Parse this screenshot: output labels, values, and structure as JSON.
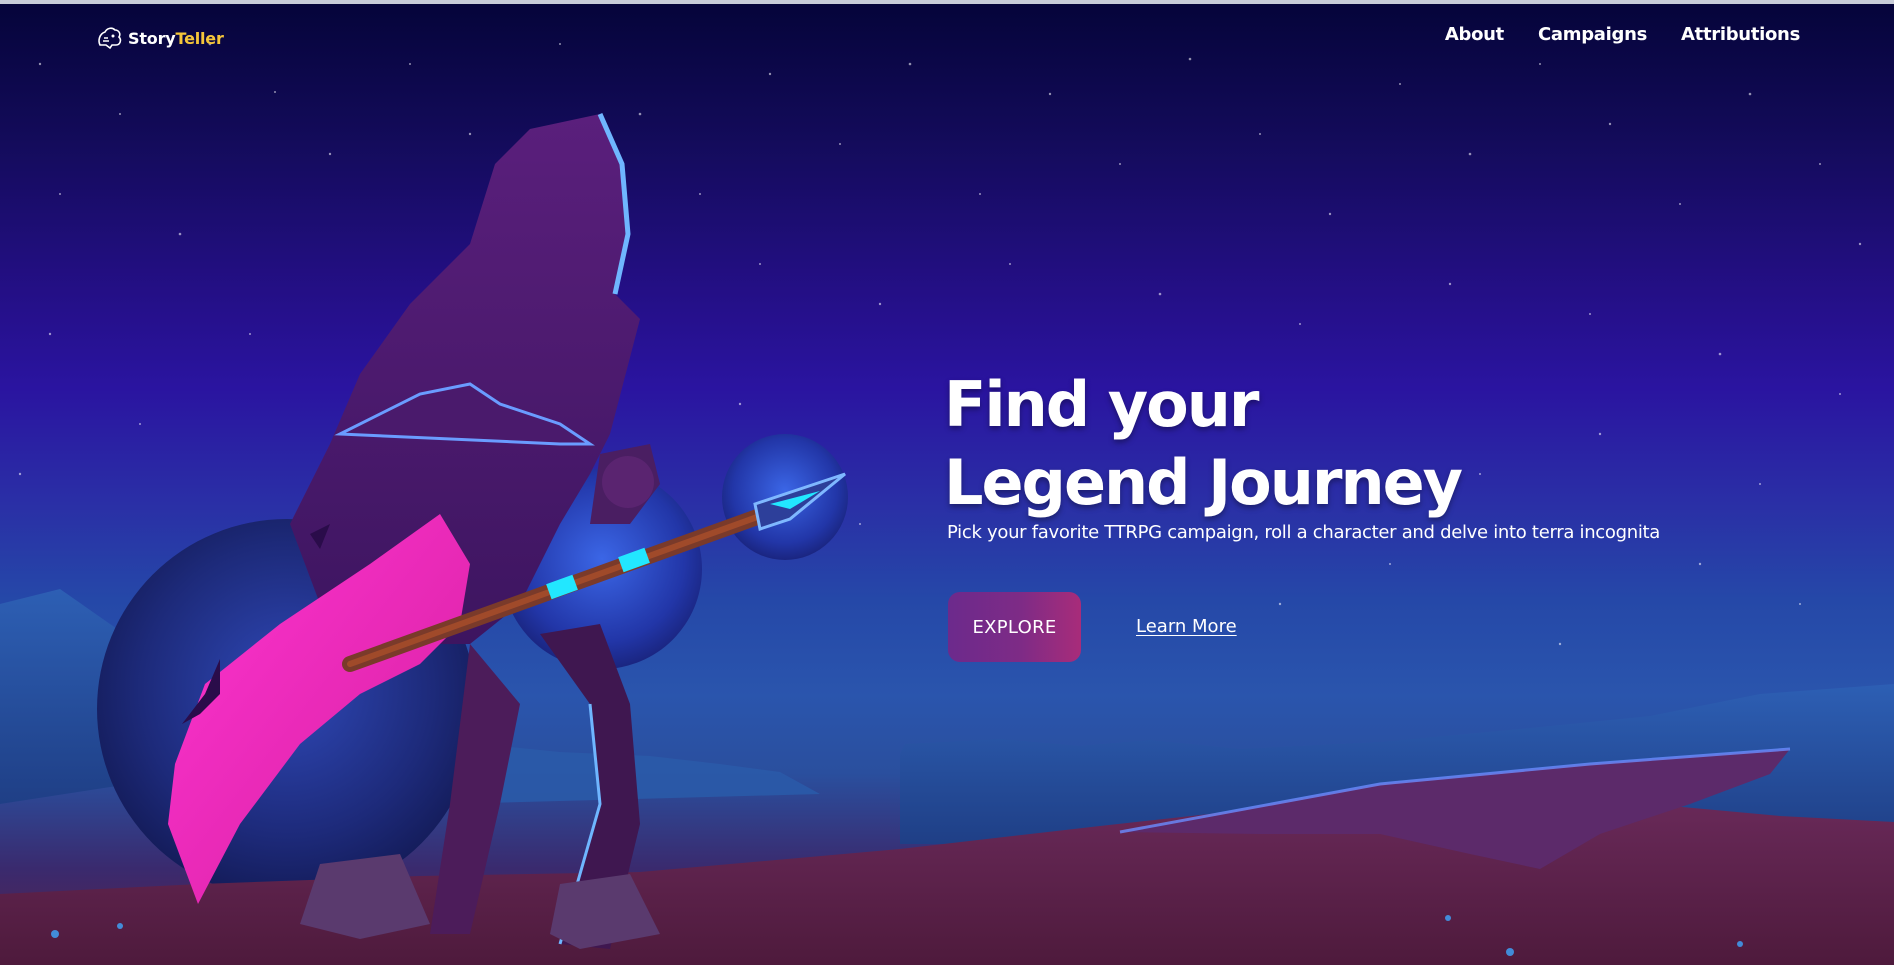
{
  "brand": {
    "name_part1": "Story",
    "name_part2": "Teller",
    "accent_color": "#f5c63a",
    "icon": "dragon-logo-icon"
  },
  "nav": {
    "items": [
      {
        "label": "About"
      },
      {
        "label": "Campaigns"
      },
      {
        "label": "Attributions"
      }
    ]
  },
  "hero": {
    "headline_line1": "Find your",
    "headline_line2": "Legend Journey",
    "tagline": "Pick your favorite TTRPG campaign, roll a character and delve into terra incognita",
    "explore_label": "EXPLORE",
    "learn_more_label": "Learn More",
    "illustration": "hooded-warrior-with-spear-night-landscape"
  },
  "colors": {
    "sky_top": "#05043a",
    "sky_mid": "#2a14a0",
    "ground": "#5a1f46",
    "axe_pink": "#ff2fc8",
    "spear_glow": "#22e7ff",
    "button_gradient_start": "#6c2a8c",
    "button_gradient_end": "#a82c7a"
  }
}
